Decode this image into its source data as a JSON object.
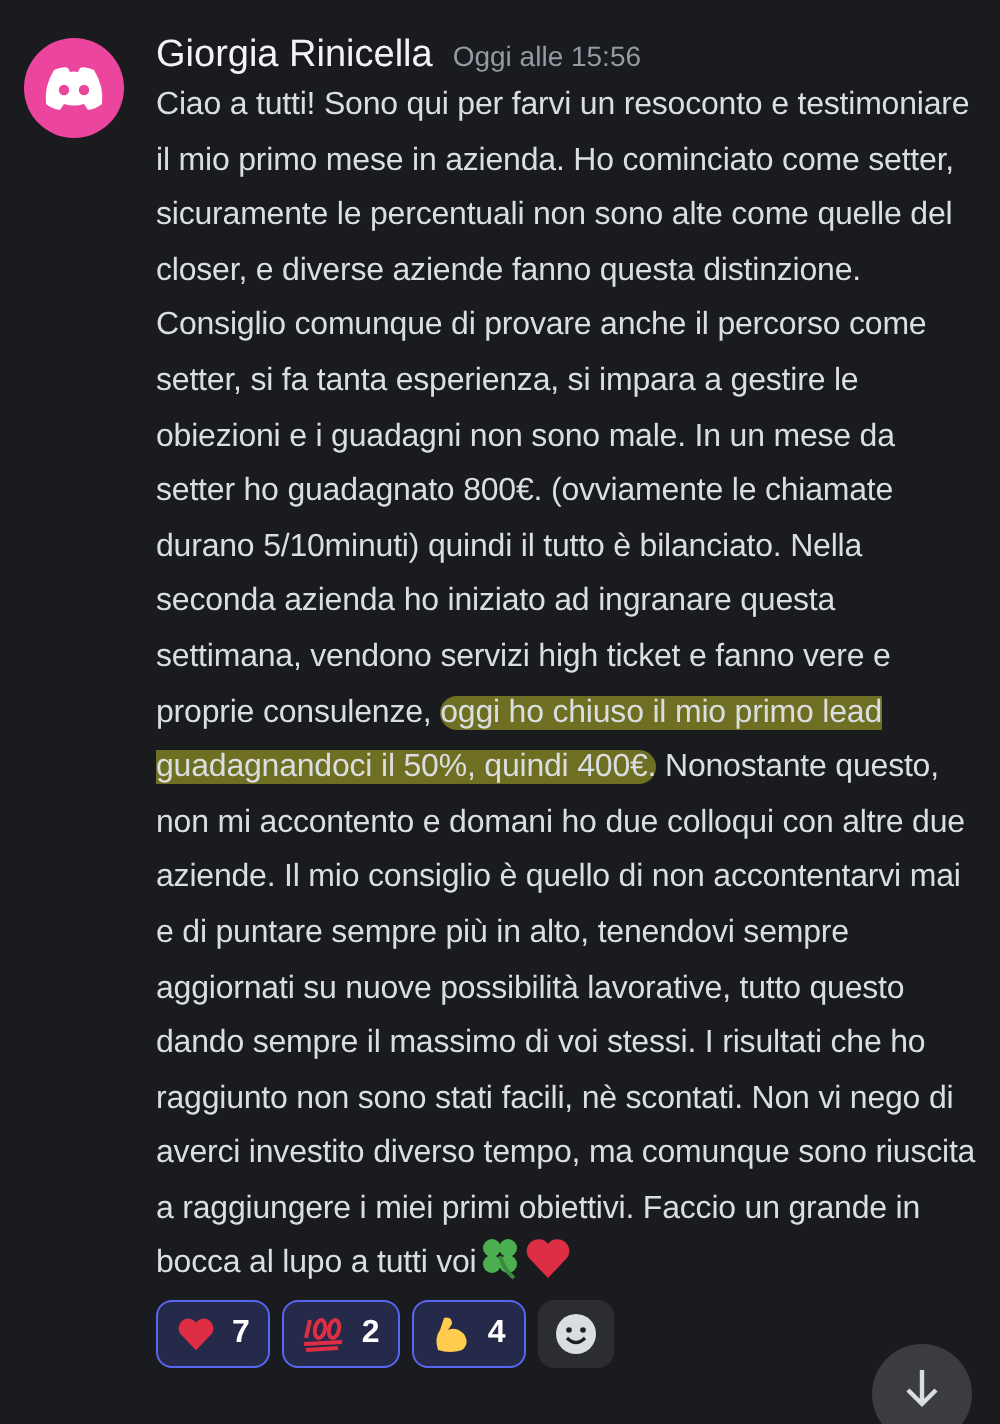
{
  "message": {
    "author": "Giorgia Rinicella",
    "timestamp": "Oggi alle 15:56",
    "segments": [
      {
        "text": "Ciao a tutti! Sono qui per farvi un resoconto e testimoniare il mio primo mese in azienda. Ho cominciato come setter, sicuramente le percentuali non sono alte come quelle del closer, e diverse aziende fanno questa distinzione. Consiglio comunque di provare anche il percorso come setter, si fa tanta esperienza, si impara a gestire le obiezioni e i guadagni non sono male. In un mese da setter ho guadagnato 800€. (ovviamente le chiamate durano 5/10minuti) quindi il tutto è bilanciato. Nella seconda azienda ho iniziato ad ingranare questa settimana, vendono servizi high ticket e fanno vere e proprie consulenze, ",
        "highlighted": false
      },
      {
        "text": "oggi ho chiuso il mio primo lead guadagnandoci il 50%, quindi 400€.",
        "highlighted": true
      },
      {
        "text": " Nonostante questo, non mi accontento e domani ho due colloqui con altre due aziende. Il mio consiglio è quello di non accontentarvi mai e di puntare sempre più in alto, tenendovi sempre aggiornati su nuove possibilità lavorative, tutto questo dando sempre il massimo di voi stessi. I risultati che ho raggiunto non sono stati facili, nè scontati. Non vi nego di averci investito diverso tempo, ma comunque sono riuscita a raggiungere i miei primi obiettivi. Faccio un grande in bocca al lupo a tutti voi",
        "highlighted": false
      }
    ],
    "reactions": [
      {
        "kind": "heart",
        "count": "7",
        "selected": true
      },
      {
        "kind": "hundred",
        "count": "2",
        "selected": true
      },
      {
        "kind": "biceps",
        "count": "4",
        "selected": true
      }
    ]
  }
}
